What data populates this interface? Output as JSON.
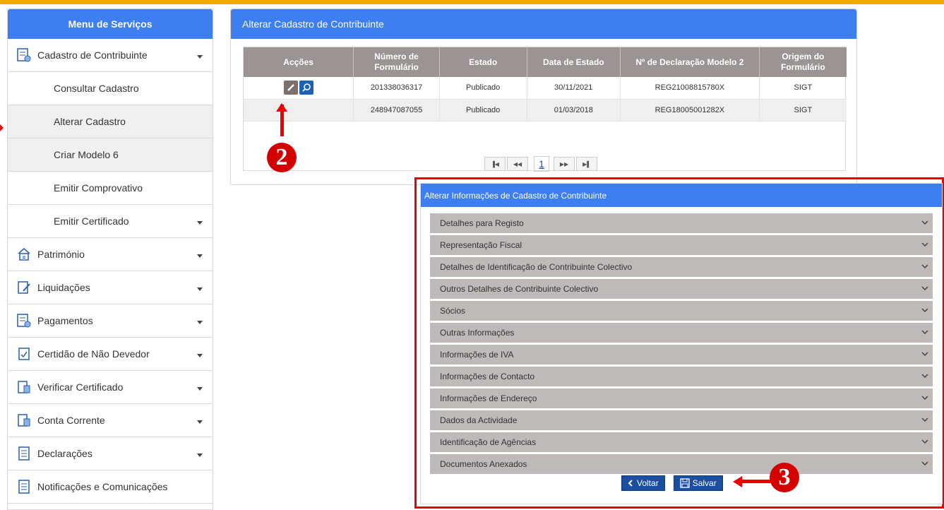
{
  "sidebar": {
    "title": "Menu de Serviços",
    "items": [
      {
        "label": "Cadastro de Contribuinte",
        "icon": "form-icon",
        "caret": true
      },
      {
        "label": "Consultar Cadastro",
        "sub": true
      },
      {
        "label": "Alterar Cadastro",
        "sub": true,
        "active": true
      },
      {
        "label": "Criar Modelo 6",
        "sub": true
      },
      {
        "label": "Emitir Comprovativo",
        "sub": true
      },
      {
        "label": "Emitir Certificado",
        "sub": true,
        "caret": true
      },
      {
        "label": "Património",
        "icon": "house-icon",
        "caret": true
      },
      {
        "label": "Liquidações",
        "icon": "edit-doc-icon",
        "caret": true
      },
      {
        "label": "Pagamentos",
        "icon": "form-icon",
        "caret": true
      },
      {
        "label": "Certidão de Não Devedor",
        "icon": "checklist-icon",
        "caret": true
      },
      {
        "label": "Verificar Certificado",
        "icon": "document-icon",
        "caret": true
      },
      {
        "label": "Conta Corrente",
        "icon": "document-icon",
        "caret": true
      },
      {
        "label": "Declarações",
        "icon": "list-doc-icon",
        "caret": true
      },
      {
        "label": "Notificações e Comunicações",
        "icon": "list-doc-icon"
      }
    ]
  },
  "main": {
    "title": "Alterar Cadastro de Contribuinte",
    "table": {
      "headers": [
        "Acções",
        "Número de Formulário",
        "Estado",
        "Data de Estado",
        "Nº de Declaração Modelo 2",
        "Origem do Formulário"
      ],
      "rows": [
        [
          "",
          "201338036317",
          "Publicado",
          "30/11/2021",
          "REG21008815780X",
          "SIGT"
        ],
        [
          "",
          "248947087055",
          "Publicado",
          "01/03/2018",
          "REG18005001282X",
          "SIGT"
        ]
      ]
    },
    "pager": {
      "current": "1"
    }
  },
  "modal": {
    "title": "Alterar Informações de Cadastro de Contribuinte",
    "sections": [
      "Detalhes para Registo",
      "Representação Fiscal",
      "Detalhes de Identificação de Contribuinte Colectivo",
      "Outros Detalhes de Contribuinte Colectivo",
      "Sócios",
      "Outras Informações",
      "Informações de IVA",
      "Informações de Contacto",
      "Informações de Endereço",
      "Dados da Actividade",
      "Identificação de Agências",
      "Documentos Anexados"
    ],
    "back_label": "Voltar",
    "save_label": "Salvar"
  },
  "annotations": {
    "step2": "2",
    "step3": "3"
  },
  "colors": {
    "accent": "#3d7ff0",
    "header_grey": "#9b9492",
    "annotation_red": "#e00000",
    "topbar": "#f5a800"
  }
}
